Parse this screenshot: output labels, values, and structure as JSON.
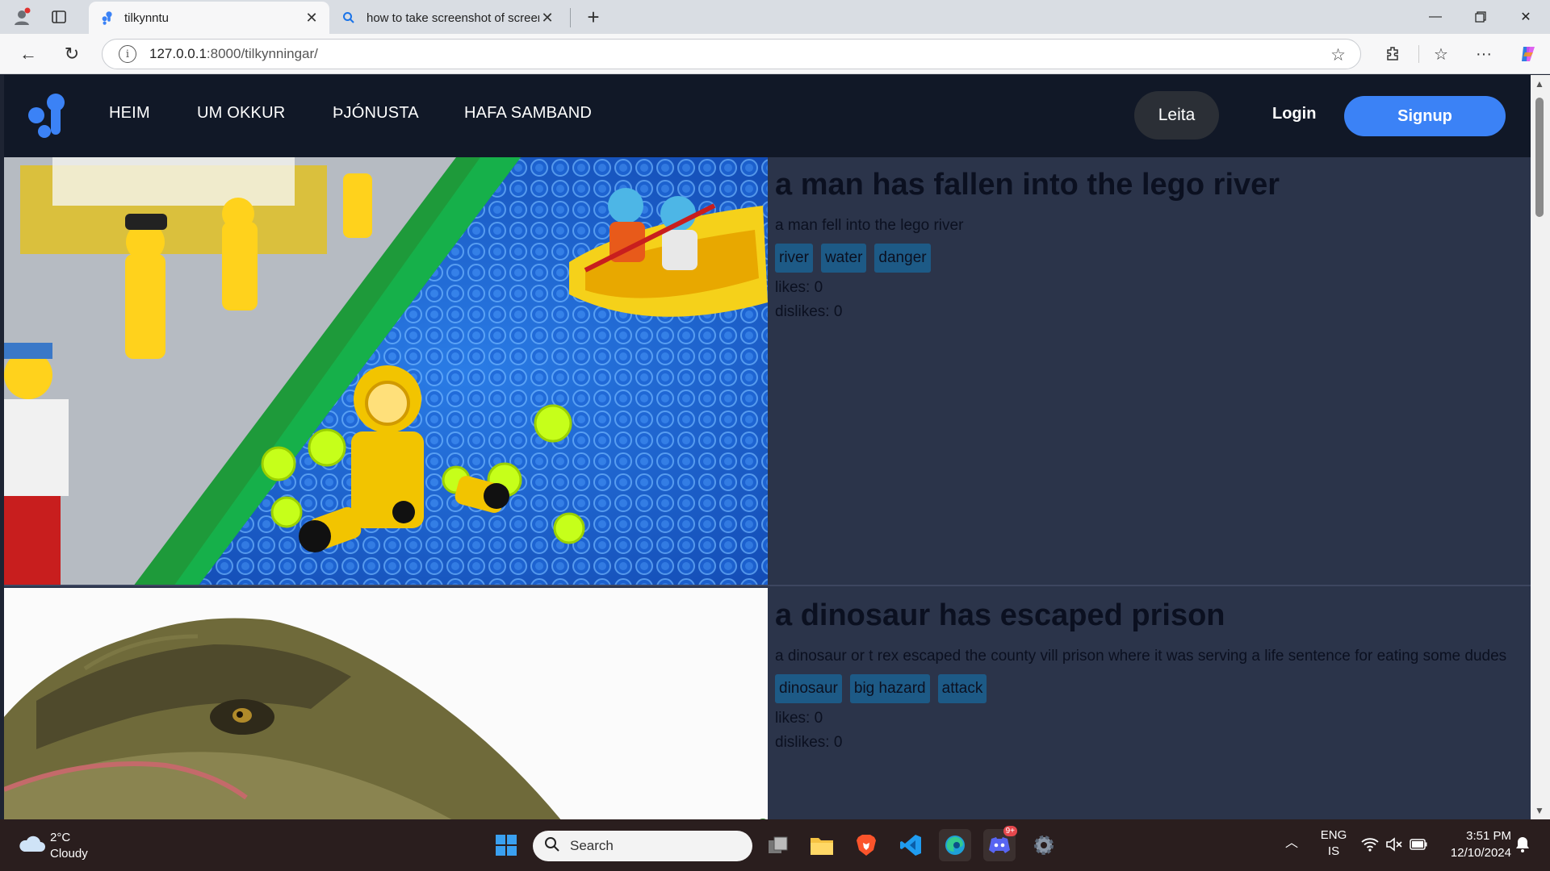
{
  "browser": {
    "tabs": [
      {
        "title": "tilkynntu",
        "active": true
      },
      {
        "title": "how to take screenshot of screen",
        "active": false
      }
    ],
    "url_host": "127.0.0.1",
    "url_path": ":8000/tilkynningar/"
  },
  "site": {
    "nav": [
      "HEIM",
      "UM OKKUR",
      "ÞJÓNUSTA",
      "HAFA SAMBAND"
    ],
    "search_label": "Leita",
    "login_label": "Login",
    "signup_label": "Signup",
    "accent": "#3b82f6"
  },
  "posts": [
    {
      "title": "a man has fallen into the lego river",
      "description": "a man fell into the lego river",
      "tags": [
        "river",
        "water",
        "danger"
      ],
      "likes": "likes: 0",
      "dislikes": "dislikes: 0",
      "image": "lego-river-photo"
    },
    {
      "title": "a dinosaur has escaped prison",
      "description": "a dinosaur or t rex escaped the county vill prison where it was serving a life sentence for eating some dudes",
      "tags": [
        "dinosaur",
        "big hazard",
        "attack"
      ],
      "likes": "likes: 0",
      "dislikes": "dislikes: 0",
      "image": "dinosaur-photo"
    }
  ],
  "taskbar": {
    "weather_temp": "2°C",
    "weather_desc": "Cloudy",
    "search_placeholder": "Search",
    "lang_top": "ENG",
    "lang_bottom": "IS",
    "time": "3:51 PM",
    "date": "12/10/2024",
    "discord_badge": "9+"
  }
}
